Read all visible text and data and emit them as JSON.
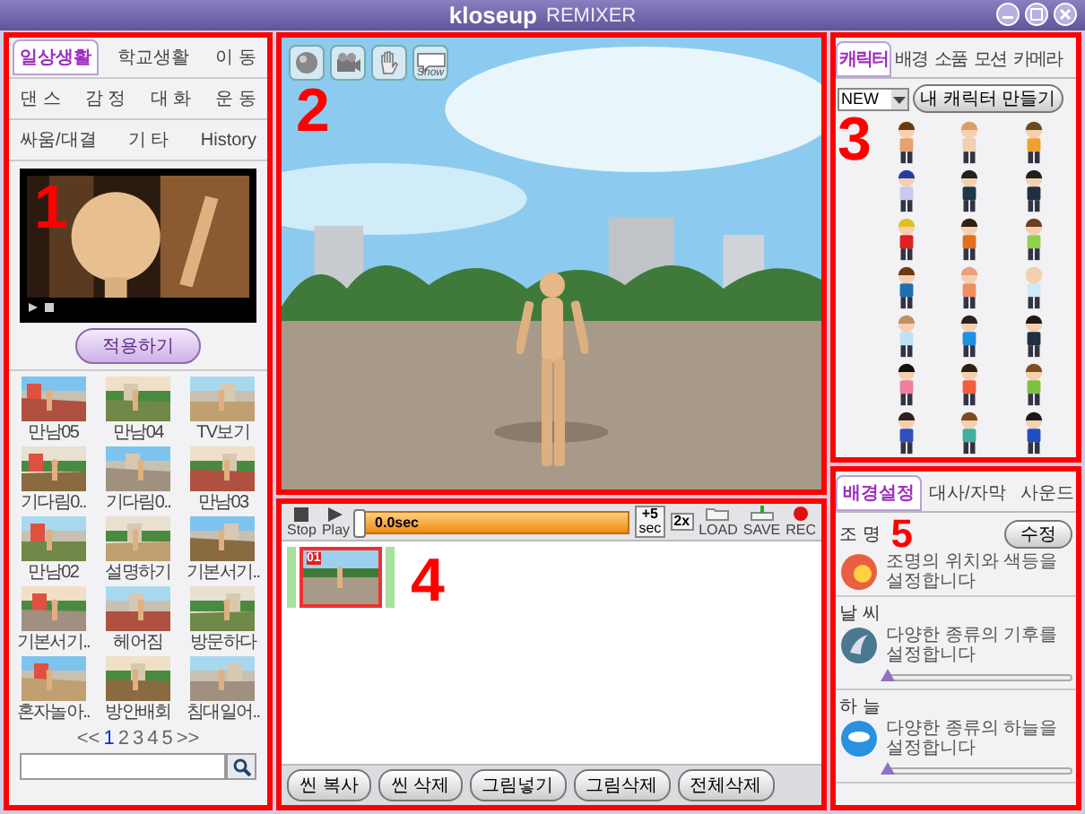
{
  "window": {
    "brand": "kloseup",
    "product": "REMIXER"
  },
  "motion_panel": {
    "callout": "1",
    "tab_rows": [
      [
        {
          "label": "일상생활",
          "selected": true
        },
        {
          "label": "학교생활",
          "selected": false
        },
        {
          "label": "이 동",
          "selected": false
        }
      ],
      [
        {
          "label": "댄 스",
          "selected": false
        },
        {
          "label": "감 정",
          "selected": false
        },
        {
          "label": "대 화",
          "selected": false
        },
        {
          "label": "운 동",
          "selected": false
        }
      ],
      [
        {
          "label": "싸움/대결",
          "selected": false
        },
        {
          "label": "기 타",
          "selected": false
        },
        {
          "label": "History",
          "selected": false
        }
      ]
    ],
    "apply_button": "적용하기",
    "items": [
      {
        "label": "만남05"
      },
      {
        "label": "만남04"
      },
      {
        "label": "TV보기"
      },
      {
        "label": "기다림0.."
      },
      {
        "label": "기다림0.."
      },
      {
        "label": "만남03"
      },
      {
        "label": "만남02"
      },
      {
        "label": "설명하기"
      },
      {
        "label": "기본서기.."
      },
      {
        "label": "기본서기.."
      },
      {
        "label": "헤어짐"
      },
      {
        "label": "방문하다"
      },
      {
        "label": "혼자놀아.."
      },
      {
        "label": "방안배회"
      },
      {
        "label": "침대일어.."
      }
    ],
    "pager": {
      "prev": "<<",
      "pages": [
        {
          "label": "1",
          "selected": true
        },
        {
          "label": "2",
          "selected": false
        },
        {
          "label": "3",
          "selected": false
        },
        {
          "label": "4",
          "selected": false
        },
        {
          "label": "5",
          "selected": false
        }
      ],
      "next": ">>"
    }
  },
  "viewport": {
    "callout": "2",
    "tools": [
      {
        "kind": "globe"
      },
      {
        "kind": "camera"
      },
      {
        "kind": "hand"
      },
      {
        "kind": "bubble",
        "label": "Show"
      }
    ]
  },
  "timeline": {
    "callout": "4",
    "controls": [
      {
        "kind": "stop",
        "label": "Stop"
      },
      {
        "kind": "play",
        "label": "Play"
      }
    ],
    "time": "0.0sec",
    "speed": [
      {
        "top": "+5",
        "bottom": "sec"
      },
      {
        "top": "2x"
      }
    ],
    "file_buttons": [
      {
        "kind": "load",
        "label": "LOAD"
      },
      {
        "kind": "save",
        "label": "SAVE"
      },
      {
        "kind": "rec",
        "label": "REC"
      }
    ],
    "scenes": [
      {
        "number": "01",
        "selected": true
      }
    ],
    "buttons": [
      "씬 복사",
      "씬 삭제",
      "그림넣기",
      "그림삭제",
      "전체삭제"
    ]
  },
  "object_panel": {
    "callout": "3",
    "tabs": [
      {
        "label": "캐릭터",
        "selected": true
      },
      {
        "label": "배경",
        "selected": false
      },
      {
        "label": "소품",
        "selected": false
      },
      {
        "label": "모션",
        "selected": false
      },
      {
        "label": "카메라",
        "selected": false
      }
    ],
    "filter": {
      "value": "NEW"
    },
    "create_button": "내 캐릭터 만들기",
    "characters": [
      {
        "color": "#e8a070"
      },
      {
        "color": "#f0d0b0"
      },
      {
        "color": "#f0a030"
      },
      {
        "color": "#c8c8f0"
      },
      {
        "color": "#203848"
      },
      {
        "color": "#203040"
      },
      {
        "color": "#e02020"
      },
      {
        "color": "#e07020"
      },
      {
        "color": "#90d050"
      },
      {
        "color": "#2070b0"
      },
      {
        "color": "#f09060"
      },
      {
        "color": "#d0e8f8"
      },
      {
        "color": "#c0e0f8"
      },
      {
        "color": "#2090e0"
      },
      {
        "color": "#203040"
      },
      {
        "color": "#f080a0"
      },
      {
        "color": "#f06040"
      },
      {
        "color": "#80c040"
      },
      {
        "color": "#3050c0"
      },
      {
        "color": "#40b0a0"
      },
      {
        "color": "#2050c0"
      }
    ]
  },
  "scene_panel": {
    "callout": "5",
    "tabs": [
      {
        "label": "배경설정",
        "selected": true
      },
      {
        "label": "대사/자막",
        "selected": false
      },
      {
        "label": "사운드",
        "selected": false
      }
    ],
    "settings": [
      {
        "kind": "lighting",
        "label": "조 명",
        "description": "조명의 위치와 색등을 설정합니다",
        "button": "수정"
      },
      {
        "kind": "weather",
        "label": "날 씨",
        "description": "다양한 종류의 기후를 설정합니다",
        "level": 0
      },
      {
        "kind": "sky",
        "label": "하 늘",
        "description": "다양한 종류의 하늘을 설정합니다",
        "level": 0
      }
    ]
  }
}
